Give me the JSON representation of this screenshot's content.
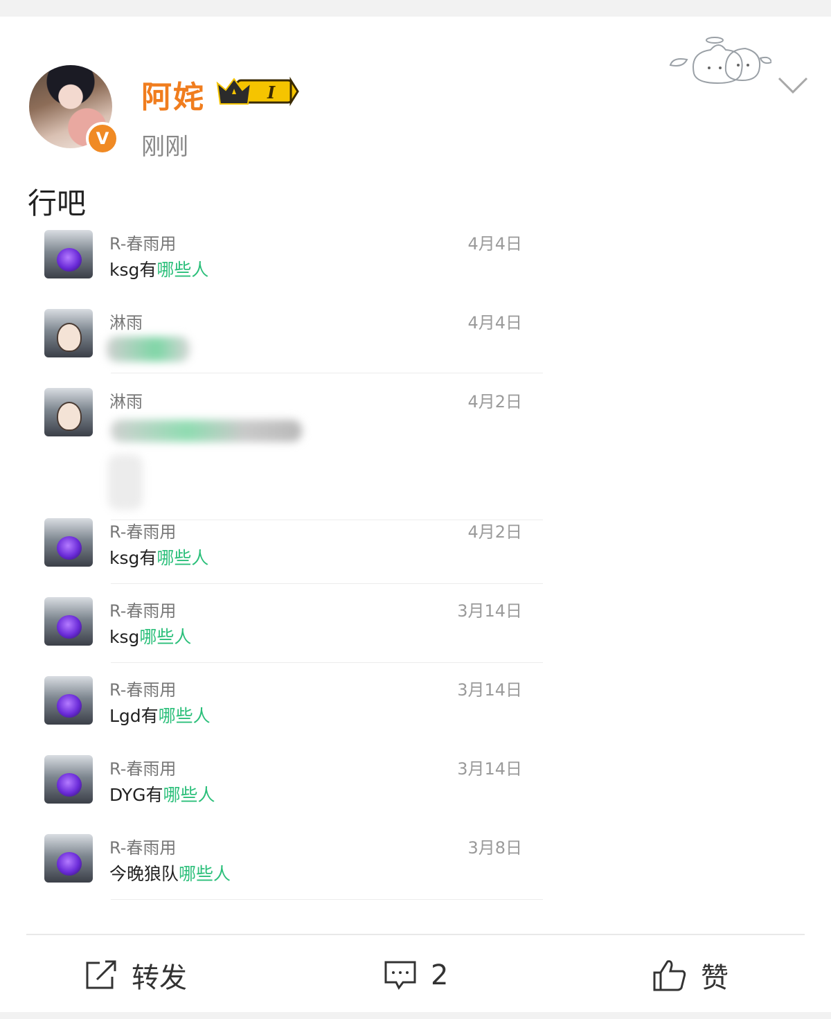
{
  "post": {
    "username": "阿姹",
    "vip_level": "I",
    "verified_badge": "V",
    "time": "刚刚",
    "text": "行吧"
  },
  "comments": [
    {
      "name": "R-春雨用",
      "date": "4月4日",
      "prefix": "ksg有",
      "highlight": "哪些人"
    },
    {
      "name": "淋雨",
      "date": "4月4日"
    },
    {
      "name": "淋雨",
      "date": "4月2日"
    },
    {
      "name": "R-春雨用",
      "date": "4月2日",
      "prefix": "ksg有",
      "highlight": "哪些人"
    },
    {
      "name": "R-春雨用",
      "date": "3月14日",
      "prefix": "ksg",
      "highlight": "哪些人"
    },
    {
      "name": "R-春雨用",
      "date": "3月14日",
      "prefix": "Lgd有",
      "highlight": "哪些人"
    },
    {
      "name": "R-春雨用",
      "date": "3月14日",
      "prefix": "DYG有",
      "highlight": "哪些人"
    },
    {
      "name": "R-春雨用",
      "date": "3月8日",
      "prefix": "今晚狼队",
      "highlight": "哪些人"
    }
  ],
  "actions": {
    "repost": "转发",
    "comment_count": "2",
    "like": "赞"
  },
  "icons": {
    "repost": "share-icon",
    "comment": "comment-icon",
    "like": "thumbs-up-icon",
    "more": "chevron-down-icon",
    "decoration": "cats-sticker-icon"
  },
  "colors": {
    "username": "#f07d1e",
    "highlight": "#2bbf7a",
    "badge": "#f08a24"
  }
}
